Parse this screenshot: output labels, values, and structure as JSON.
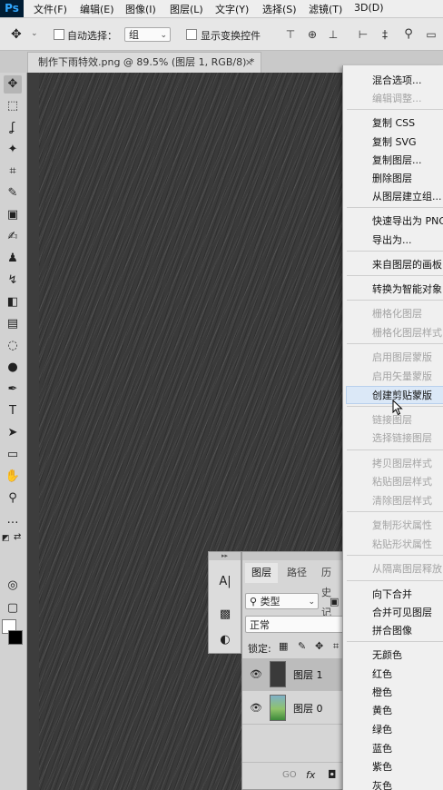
{
  "app": {
    "logo": "Ps"
  },
  "menubar": {
    "items": [
      "文件(F)",
      "编辑(E)",
      "图像(I)",
      "图层(L)",
      "文字(Y)",
      "选择(S)",
      "滤镜(T)",
      "3D(D)"
    ]
  },
  "options": {
    "auto_select_label": "自动选择：",
    "auto_select_value": "组",
    "show_transform_label": "显示变换控件"
  },
  "document": {
    "tab_title": "制作下雨特效.png @ 89.5% (图层 1, RGB/8) *",
    "close_glyph": "×"
  },
  "layers_panel": {
    "tabs": [
      "图层",
      "路径",
      "历史记"
    ],
    "filter_value": "类型",
    "blend_mode": "正常",
    "lock_label": "锁定:",
    "layers": [
      {
        "name": "图层 1",
        "selected": true
      },
      {
        "name": "图层 0",
        "selected": false
      }
    ],
    "footer": [
      "GO",
      "fx"
    ]
  },
  "context_menu": {
    "highlight_color": "#dbe8f7",
    "items": [
      {
        "label": "混合选项...",
        "disabled": false
      },
      {
        "label": "编辑调整...",
        "disabled": true
      },
      {
        "label": "复制 CSS",
        "disabled": false
      },
      {
        "label": "复制 SVG",
        "disabled": false
      },
      {
        "label": "复制图层...",
        "disabled": false
      },
      {
        "label": "删除图层",
        "disabled": false
      },
      {
        "label": "从图层建立组...",
        "disabled": false
      },
      {
        "label": "快速导出为 PNG",
        "disabled": false
      },
      {
        "label": "导出为...",
        "disabled": false
      },
      {
        "label": "来自图层的画板...",
        "disabled": false
      },
      {
        "label": "转换为智能对象",
        "disabled": false
      },
      {
        "label": "栅格化图层",
        "disabled": true
      },
      {
        "label": "栅格化图层样式",
        "disabled": true
      },
      {
        "label": "启用图层蒙版",
        "disabled": true
      },
      {
        "label": "启用矢量蒙版",
        "disabled": true
      },
      {
        "label": "创建剪贴蒙版",
        "disabled": false,
        "highlighted": true
      },
      {
        "label": "链接图层",
        "disabled": true
      },
      {
        "label": "选择链接图层",
        "disabled": true
      },
      {
        "label": "拷贝图层样式",
        "disabled": true
      },
      {
        "label": "粘贴图层样式",
        "disabled": true
      },
      {
        "label": "清除图层样式",
        "disabled": true
      },
      {
        "label": "复制形状属性",
        "disabled": true
      },
      {
        "label": "粘贴形状属性",
        "disabled": true
      },
      {
        "label": "从隔离图层释放",
        "disabled": true
      },
      {
        "label": "向下合并",
        "disabled": false
      },
      {
        "label": "合并可见图层",
        "disabled": false
      },
      {
        "label": "拼合图像",
        "disabled": false
      },
      {
        "label": "无颜色",
        "disabled": false
      },
      {
        "label": "红色",
        "disabled": false
      },
      {
        "label": "橙色",
        "disabled": false
      },
      {
        "label": "黄色",
        "disabled": false
      },
      {
        "label": "绿色",
        "disabled": false
      },
      {
        "label": "蓝色",
        "disabled": false
      },
      {
        "label": "紫色",
        "disabled": false
      },
      {
        "label": "灰色",
        "disabled": false
      }
    ]
  }
}
